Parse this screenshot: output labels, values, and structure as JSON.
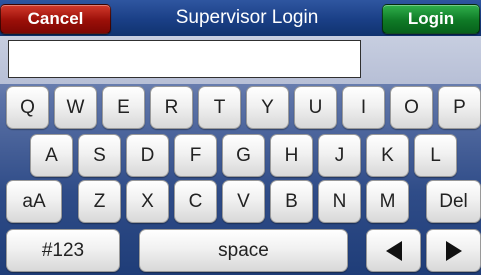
{
  "header": {
    "cancel_label": "Cancel",
    "title": "Supervisor Login",
    "login_label": "Login"
  },
  "input": {
    "value": "",
    "placeholder": ""
  },
  "keyboard": {
    "row1": [
      "Q",
      "W",
      "E",
      "R",
      "T",
      "Y",
      "U",
      "I",
      "O",
      "P"
    ],
    "row2": [
      "A",
      "S",
      "D",
      "F",
      "G",
      "H",
      "J",
      "K",
      "L"
    ],
    "row3": [
      "Z",
      "X",
      "C",
      "V",
      "B",
      "N",
      "M"
    ],
    "shift_label": "aA",
    "delete_label": "Del",
    "numbers_label": "#123",
    "space_label": "space",
    "left_arrow_icon": "left-arrow-icon",
    "right_arrow_icon": "right-arrow-icon"
  },
  "colors": {
    "cancel": "#9b0f08",
    "login": "#0f7a26",
    "header": "#1a3f86"
  }
}
